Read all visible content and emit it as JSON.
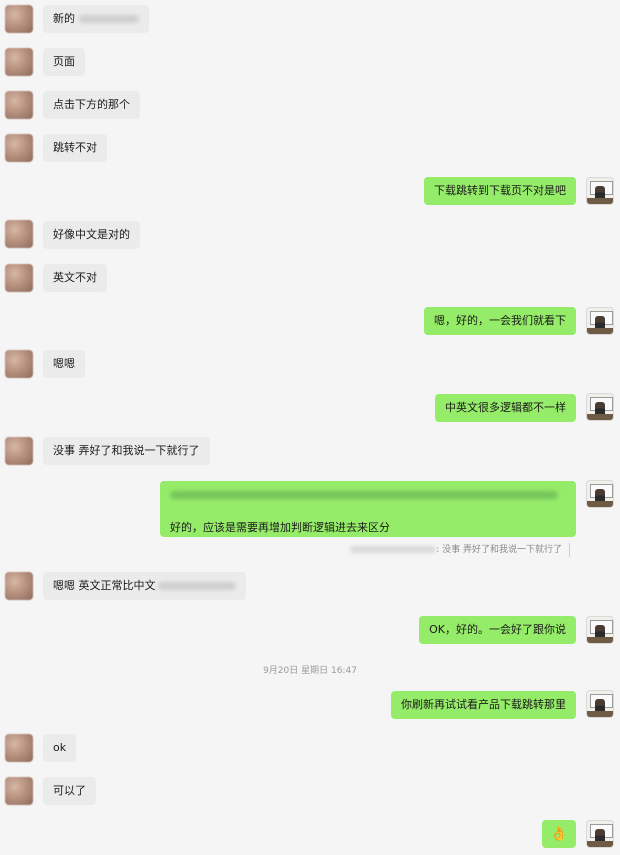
{
  "messages": [
    {
      "side": "other",
      "text": "新的",
      "redacted": true
    },
    {
      "side": "other",
      "text": "页面"
    },
    {
      "side": "other",
      "text": "点击下方的那个"
    },
    {
      "side": "other",
      "text": "跳转不对"
    },
    {
      "side": "me",
      "text": "下载跳转到下载页不对是吧"
    },
    {
      "side": "other",
      "text": "好像中文是对的"
    },
    {
      "side": "other",
      "text": "英文不对"
    },
    {
      "side": "me",
      "text": "嗯，好的，一会我们就看下"
    },
    {
      "side": "other",
      "text": "嗯嗯"
    },
    {
      "side": "me",
      "text": "中英文很多逻辑都不一样"
    },
    {
      "side": "other",
      "text": "没事 弄好了和我说一下就行了"
    },
    {
      "side": "me",
      "text": "好的，应该是需要再增加判断逻辑进去来区分",
      "redacted_line": true
    },
    {
      "side": "other",
      "text": "嗯嗯 英文正常比中文",
      "redacted": true
    },
    {
      "side": "me",
      "text": "OK，好的。一会好了跟你说"
    },
    {
      "side": "me",
      "text": "你刷新再试试看产品下载跳转那里"
    },
    {
      "side": "other",
      "text": "ok"
    },
    {
      "side": "other",
      "text": "可以了"
    },
    {
      "side": "me",
      "text": "👌"
    }
  ],
  "quote": {
    "text": ": 没事 弄好了和我说一下就行了"
  },
  "timestamp": "9月20日 星期日 16:47",
  "icons": {
    "other_avatar": "blurred-avatar",
    "me_avatar": "photo-avatar",
    "emoji": "ok-hand-icon"
  },
  "colors": {
    "bubble_me": "#95ec69",
    "bubble_other": "#ebebeb",
    "background": "#f5f5f5"
  }
}
